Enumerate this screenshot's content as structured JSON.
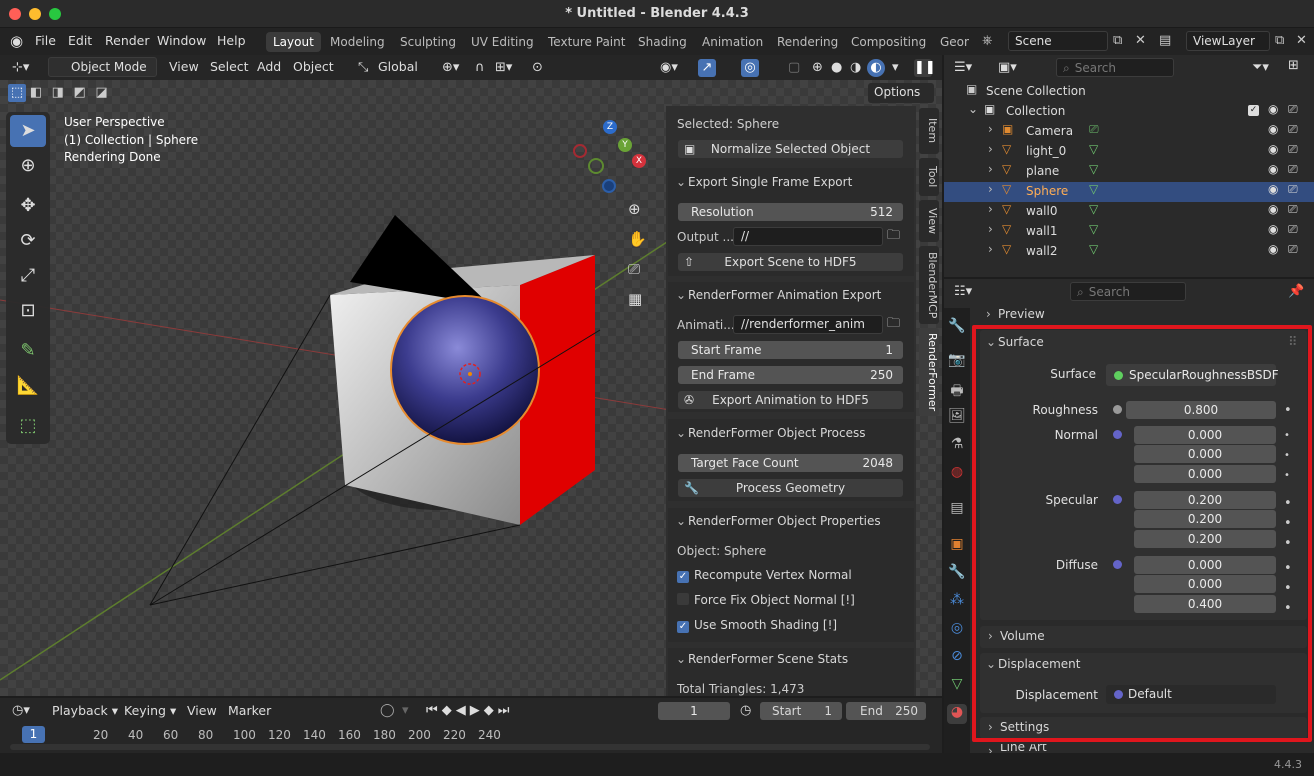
{
  "window": {
    "title": "* Untitled - Blender 4.4.3",
    "version": "4.4.3"
  },
  "menu": [
    "File",
    "Edit",
    "Render",
    "Window",
    "Help"
  ],
  "workspaces": [
    "Layout",
    "Modeling",
    "Sculpting",
    "UV Editing",
    "Texture Paint",
    "Shading",
    "Animation",
    "Rendering",
    "Compositing",
    "Geom"
  ],
  "scene": {
    "name": "Scene",
    "view_layer": "ViewLayer"
  },
  "viewport": {
    "mode": "Object Mode",
    "menus": [
      "View",
      "Select",
      "Add",
      "Object"
    ],
    "transform": "Global",
    "options": "Options",
    "overlay": [
      "User Perspective",
      "(1) Collection | Sphere",
      "Rendering Done"
    ]
  },
  "npanel": {
    "selected": "Selected: Sphere",
    "normalize_btn": "Normalize Selected Object",
    "export_single": {
      "title": "Export Single Frame Export",
      "res_label": "Resolution",
      "res_value": "512",
      "output_label": "Output ...",
      "output_value": "//",
      "export_btn": "Export Scene to HDF5"
    },
    "anim": {
      "title": "RenderFormer Animation Export",
      "anim_label": "Animati...",
      "anim_value": "//renderformer_anim",
      "start_label": "Start Frame",
      "start_value": "1",
      "end_label": "End Frame",
      "end_value": "250",
      "export_btn": "Export Animation to HDF5"
    },
    "process": {
      "title": "RenderFormer Object Process",
      "target_label": "Target Face Count",
      "target_value": "2048",
      "btn": "Process Geometry"
    },
    "props": {
      "title": "RenderFormer Object Properties",
      "object": "Object: Sphere",
      "cb1": "Recompute Vertex Normal",
      "cb2": "Force Fix Object Normal [!]",
      "cb3": "Use Smooth Shading [!]"
    },
    "stats": {
      "title": "RenderFormer Scene Stats",
      "triangles": "Total Triangles: 1,473"
    },
    "tabs": [
      "Item",
      "Tool",
      "View",
      "BlenderMCP",
      "RenderFormer"
    ]
  },
  "outliner": {
    "search": "Search",
    "root": "Scene Collection",
    "collection": "Collection",
    "items": [
      {
        "name": "Camera",
        "selected": false
      },
      {
        "name": "light_0",
        "selected": false
      },
      {
        "name": "plane",
        "selected": false
      },
      {
        "name": "Sphere",
        "selected": true
      },
      {
        "name": "wall0",
        "selected": false
      },
      {
        "name": "wall1",
        "selected": false
      },
      {
        "name": "wall2",
        "selected": false
      }
    ]
  },
  "properties": {
    "search": "Search",
    "preview": "Preview",
    "surface_header": "Surface",
    "surface_label": "Surface",
    "surface_value": "SpecularRoughnessBSDF",
    "roughness_label": "Roughness",
    "roughness": "0.800",
    "normal_label": "Normal",
    "normal": [
      "0.000",
      "0.000",
      "0.000"
    ],
    "specular_label": "Specular",
    "specular": [
      "0.200",
      "0.200",
      "0.200"
    ],
    "diffuse_label": "Diffuse",
    "diffuse": [
      "0.000",
      "0.000",
      "0.400"
    ],
    "volume": "Volume",
    "displacement_header": "Displacement",
    "displacement_label": "Displacement",
    "displacement_value": "Default",
    "settings": "Settings",
    "line_art": "Line Art"
  },
  "timeline": {
    "menus": [
      "Playback",
      "Keying",
      "View",
      "Marker"
    ],
    "current": "1",
    "start_label": "Start",
    "start": "1",
    "end_label": "End",
    "end": "250",
    "frame_badge": "1",
    "ticks": [
      "20",
      "40",
      "60",
      "80",
      "100",
      "120",
      "140",
      "160",
      "180",
      "200",
      "220",
      "240"
    ]
  },
  "colors": {
    "highlight": "#e0161d",
    "accent": "#4772b3",
    "selected_row": "#334d80"
  }
}
